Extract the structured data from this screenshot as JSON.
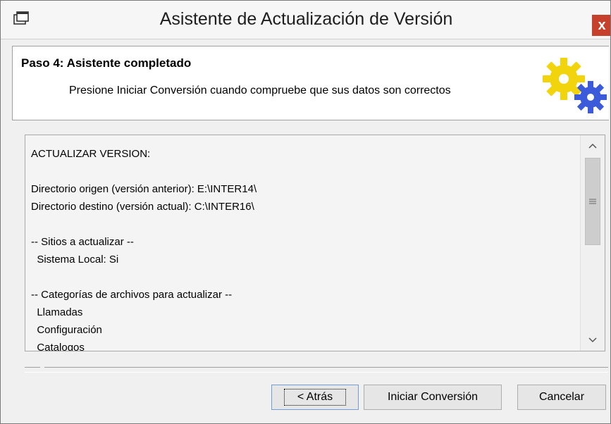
{
  "window": {
    "title": "Asistente de Actualización de Versión",
    "close_label": "x"
  },
  "header": {
    "step_title": "Paso 4: Asistente completado",
    "step_description": "Presione Iniciar Conversión cuando compruebe que sus datos son correctos"
  },
  "summary": {
    "lines": [
      "ACTUALIZAR VERSION:",
      "",
      "Directorio origen (versión anterior): E:\\INTER14\\",
      "Directorio destino (versión actual): C:\\INTER16\\",
      "",
      "-- Sitios a actualizar --",
      "  Sistema Local: Si",
      "",
      "-- Categorías de archivos para actualizar --",
      "  Llamadas",
      "  Configuración",
      "  Catalogos"
    ]
  },
  "buttons": {
    "back_label": "< Atrás",
    "start_label": "Iniciar Conversión",
    "cancel_label": "Cancelar"
  },
  "icons": {
    "title_icon": "wizard-window-icon",
    "header_icon": "gears-icon"
  },
  "colors": {
    "close_button": "#c7402c",
    "gear_yellow": "#f2d40c",
    "gear_blue": "#3b5bdb"
  }
}
